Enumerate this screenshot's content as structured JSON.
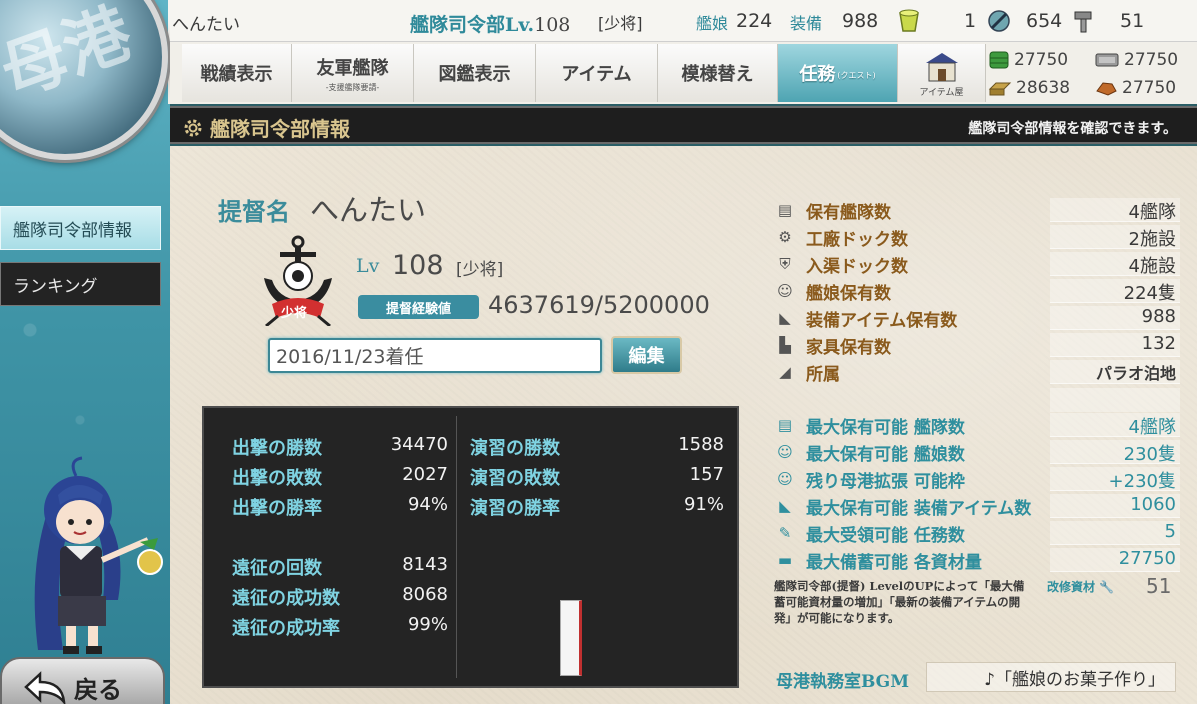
{
  "top": {
    "username": "へんたい",
    "hq_label": "艦隊司令部Lv.",
    "hq_level": "108",
    "rank": "[少将]",
    "ships_label": "艦娘",
    "ships_count": "224",
    "equip_label": "装備",
    "equip_count": "988",
    "bucket_count": "1",
    "devmat_count": "654",
    "screw_count": "51",
    "menu": [
      {
        "label": "戦績表示",
        "sub": ""
      },
      {
        "label": "友軍艦隊",
        "sub": "-支援艦隊要請-"
      },
      {
        "label": "図鑑表示",
        "sub": ""
      },
      {
        "label": "アイテム",
        "sub": ""
      },
      {
        "label": "模様替え",
        "sub": ""
      },
      {
        "label": "任務",
        "sub": "(クエスト)"
      }
    ],
    "item_shop_label": "アイテム屋",
    "resources": {
      "fuel": "27750",
      "ammo": "27750",
      "steel": "28638",
      "bauxite": "27750"
    }
  },
  "title": {
    "heading": "艦隊司令部情報",
    "subtitle": "艦隊司令部情報を確認できます。"
  },
  "sidebar": {
    "items": [
      "艦隊司令部情報",
      "ランキング"
    ],
    "back_label": "戻る"
  },
  "profile": {
    "name_label": "提督名",
    "name": "へんたい",
    "lv_label": "Lv",
    "level": "108",
    "rank": "[少将]",
    "rank_badge": "少将",
    "exp_label": "提督経験値",
    "exp": "4637619/5200000",
    "comment": "2016/11/23着任",
    "edit_label": "編集"
  },
  "stats": {
    "left": [
      {
        "k": "出撃の勝数",
        "v": "34470"
      },
      {
        "k": "出撃の敗数",
        "v": "2027"
      },
      {
        "k": "出撃の勝率",
        "v": "94%"
      },
      {
        "k": "遠征の回数",
        "v": "8143"
      },
      {
        "k": "遠征の成功数",
        "v": "8068"
      },
      {
        "k": "遠征の成功率",
        "v": "99%"
      }
    ],
    "right": [
      {
        "k": "演習の勝数",
        "v": "1588"
      },
      {
        "k": "演習の敗数",
        "v": "157"
      },
      {
        "k": "演習の勝率",
        "v": "91%"
      }
    ]
  },
  "info": {
    "current": [
      {
        "k": "保有艦隊数",
        "v": "4艦隊",
        "icon": "fleet-icon"
      },
      {
        "k": "工廠ドック数",
        "v": "2施設",
        "icon": "gear-icon"
      },
      {
        "k": "入渠ドック数",
        "v": "4施設",
        "icon": "repair-icon"
      },
      {
        "k": "艦娘保有数",
        "v": "224隻",
        "icon": "shipgirl-icon"
      },
      {
        "k": "装備アイテム保有数",
        "v": "988",
        "icon": "equipment-icon"
      },
      {
        "k": "家具保有数",
        "v": "132",
        "icon": "furniture-icon"
      },
      {
        "k": "所属",
        "v": "パラオ泊地",
        "icon": "base-icon"
      }
    ],
    "max": [
      {
        "k": "最大保有可能 艦隊数",
        "v": "4艦隊",
        "icon": "fleet-icon"
      },
      {
        "k": "最大保有可能 艦娘数",
        "v": "230隻",
        "icon": "shipgirl-icon"
      },
      {
        "k": "残り母港拡張 可能枠",
        "v": "+230隻",
        "icon": "shipgirl-icon"
      },
      {
        "k": "最大保有可能 装備アイテム数",
        "v": "1060",
        "icon": "equipment-icon"
      },
      {
        "k": "最大受領可能 任務数",
        "v": "5",
        "icon": "quest-icon"
      },
      {
        "k": "最大備蓄可能 各資材量",
        "v": "27750",
        "icon": "resource-icon"
      }
    ],
    "notice": "艦隊司令部(提督) LevelのUPによって「最大備蓄可能資材量の増加」「最新の装備アイテムの開発」が可能になります。",
    "improve_label": "改修資材",
    "improve_value": "51",
    "bgm_label": "母港執務室BGM",
    "bgm_value": "♪「艦娘のお菓子作り」"
  }
}
